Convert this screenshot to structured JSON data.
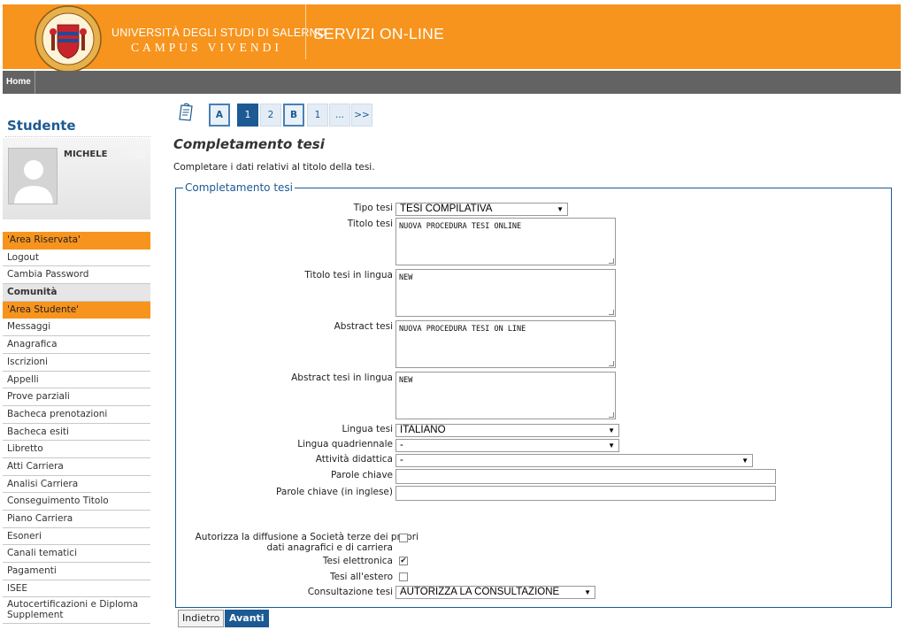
{
  "header": {
    "university_name": "UNIVERSITÀ DEGLI STUDI DI SALERNO",
    "motto": "CAMPUS VIVENDI",
    "services": "SERVIZI ON-LINE",
    "brand_color": "#f7941d"
  },
  "nav": {
    "home": "Home"
  },
  "sidebar": {
    "title": "Studente",
    "student_name": "MICHELE",
    "menu": [
      {
        "label": "'Area Riservata'",
        "type": "section"
      },
      {
        "label": "Logout",
        "type": "item"
      },
      {
        "label": "Cambia Password",
        "type": "item"
      },
      {
        "label": "Comunità",
        "type": "group"
      },
      {
        "label": "'Area Studente'",
        "type": "section"
      },
      {
        "label": "Messaggi",
        "type": "item"
      },
      {
        "label": "Anagrafica",
        "type": "item"
      },
      {
        "label": "Iscrizioni",
        "type": "item"
      },
      {
        "label": "Appelli",
        "type": "item"
      },
      {
        "label": "Prove parziali",
        "type": "item"
      },
      {
        "label": "Bacheca prenotazioni",
        "type": "item"
      },
      {
        "label": "Bacheca esiti",
        "type": "item"
      },
      {
        "label": "Libretto",
        "type": "item"
      },
      {
        "label": "Atti Carriera",
        "type": "item"
      },
      {
        "label": "Analisi Carriera",
        "type": "item"
      },
      {
        "label": "Conseguimento Titolo",
        "type": "item"
      },
      {
        "label": "Piano Carriera",
        "type": "item"
      },
      {
        "label": "Esoneri",
        "type": "item"
      },
      {
        "label": "Canali tematici",
        "type": "item"
      },
      {
        "label": "Pagamenti",
        "type": "item"
      },
      {
        "label": "ISEE",
        "type": "item"
      },
      {
        "label": "Autocertificazioni e Diploma Supplement",
        "type": "tall"
      }
    ]
  },
  "steps": [
    "A",
    "1",
    "2",
    "B",
    "1",
    "...",
    ">>"
  ],
  "page": {
    "title": "Completamento tesi",
    "description": "Completare i dati relativi al titolo della tesi.",
    "legend": "Completamento tesi"
  },
  "form": {
    "tipo_tesi": {
      "label": "Tipo tesi",
      "value": "TESI COMPILATIVA"
    },
    "titolo_tesi": {
      "label": "Titolo tesi",
      "value": "NUOVA PROCEDURA TESI ONLINE"
    },
    "titolo_tesi_lingua": {
      "label": "Titolo tesi in lingua",
      "value": "NEW"
    },
    "abstract_tesi": {
      "label": "Abstract tesi",
      "value": "NUOVA PROCEDURA TESI ON LINE"
    },
    "abstract_tesi_lingua": {
      "label": "Abstract tesi in lingua",
      "value": "NEW"
    },
    "lingua_tesi": {
      "label": "Lingua tesi",
      "value": "ITALIANO"
    },
    "lingua_quadriennale": {
      "label": "Lingua quadriennale",
      "value": "-"
    },
    "attivita_didattica": {
      "label": "Attività didattica",
      "value": "-"
    },
    "parole_chiave": {
      "label": "Parole chiave",
      "value": ""
    },
    "parole_chiave_inglese": {
      "label": "Parole chiave (in inglese)",
      "value": ""
    },
    "autorizza_diffusione": {
      "label_line1": "Autorizza la diffusione a Società terze dei propri",
      "label_line2": "dati anagrafici e di carriera",
      "checked": false
    },
    "tesi_elettronica": {
      "label": "Tesi elettronica",
      "checked": true
    },
    "tesi_estero": {
      "label": "Tesi all'estero",
      "checked": false
    },
    "consultazione_tesi": {
      "label": "Consultazione tesi",
      "value": "AUTORIZZA LA CONSULTAZIONE"
    }
  },
  "buttons": {
    "back": "Indietro",
    "next": "Avanti"
  }
}
